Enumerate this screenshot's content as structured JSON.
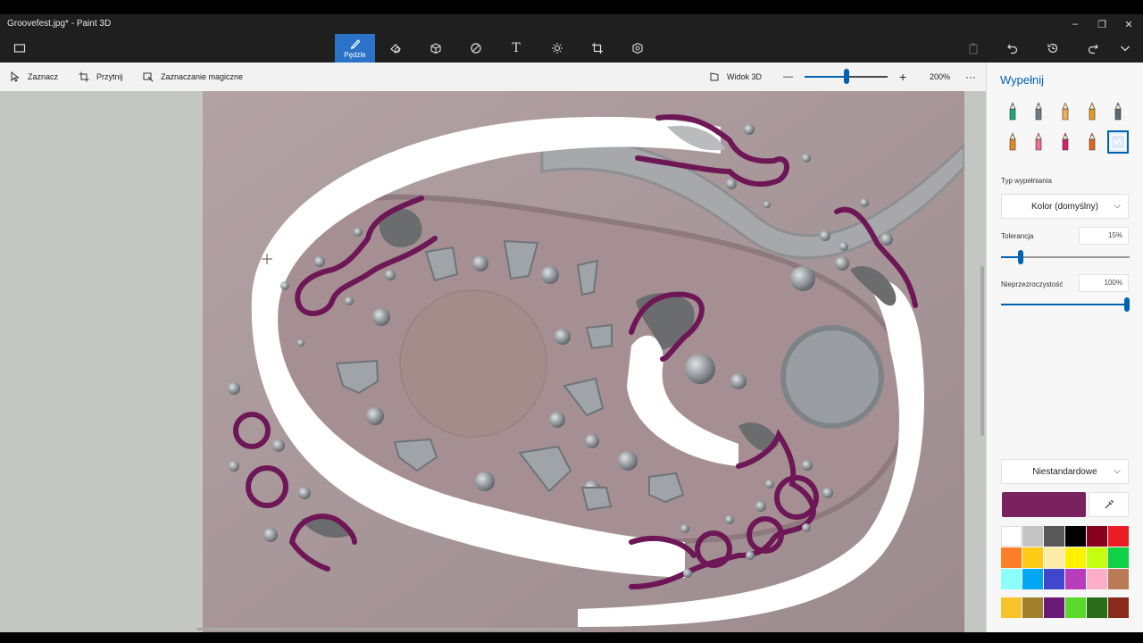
{
  "window": {
    "title": "Groovefest.jpg* - Paint 3D",
    "controls": {
      "minimize": "–",
      "maximize": "❐",
      "close": "✕"
    }
  },
  "toolbar": {
    "menu_icon": "folder-icon",
    "tools": [
      {
        "name": "brushes",
        "label": "Pędzle",
        "icon": "brush-icon",
        "active": true
      },
      {
        "name": "shapes2d",
        "icon": "shapes-2d-icon"
      },
      {
        "name": "shapes3d",
        "icon": "cube-icon"
      },
      {
        "name": "stickers",
        "icon": "sticker-icon"
      },
      {
        "name": "text",
        "icon": "text-icon",
        "glyph": "T"
      },
      {
        "name": "effects",
        "icon": "sun-icon"
      },
      {
        "name": "canvas",
        "icon": "crop-canvas-icon"
      },
      {
        "name": "library",
        "icon": "library-3d-icon"
      }
    ],
    "right": [
      "paste-icon",
      "undo-icon",
      "history-icon",
      "redo-icon",
      "expand-icon"
    ]
  },
  "subbar": {
    "select": "Zaznacz",
    "crop": "Przytnij",
    "magic_select": "Zaznaczanie magiczne",
    "view3d": "Widok 3D",
    "zoom_out": "—",
    "zoom_in": "+",
    "zoom_value": "200%",
    "zoom_fraction": 0.5,
    "more": "···"
  },
  "panel": {
    "title": "Wypełnij",
    "brushes": [
      {
        "icon": "marker-icon",
        "color": "#1fa67a"
      },
      {
        "icon": "calligraphy-pen-icon",
        "color": "#6f7b82"
      },
      {
        "icon": "oil-brush-icon",
        "color": "#f2b04c"
      },
      {
        "icon": "watercolor-icon",
        "color": "#e59a2a"
      },
      {
        "icon": "pixel-pen-icon",
        "color": "#5b6770"
      },
      {
        "icon": "pencil-icon",
        "color": "#e28a2a"
      },
      {
        "icon": "eraser-icon",
        "color": "#ee6e91"
      },
      {
        "icon": "crayon-icon",
        "color": "#d6206b"
      },
      {
        "icon": "spray-can-icon",
        "color": "#e0661e"
      },
      {
        "icon": "fill-icon",
        "color": "#2b73c8",
        "selected": true
      }
    ],
    "fill_type_label": "Typ wypełniania",
    "fill_type_value": "Kolor (domyślny)",
    "tolerance_label": "Tolerancja",
    "tolerance_value": "15%",
    "tolerance_fraction": 0.15,
    "opacity_label": "Nieprzezroczystość",
    "opacity_value": "100%",
    "opacity_fraction": 1.0,
    "custom_label": "Niestandardowe",
    "current_color": "#7a2260",
    "palette": [
      "#ffffff",
      "#c3c3c3",
      "#585858",
      "#000000",
      "#88001b",
      "#ec1c24",
      "#ff7f27",
      "#ffca18",
      "#fdeca6",
      "#fff200",
      "#c4ff0e",
      "#0ed145",
      "#8cfffb",
      "#00a8f3",
      "#3f48cc",
      "#b83dba",
      "#ffaec8",
      "#b97a56"
    ],
    "palette_custom": [
      "#f8c22a",
      "#a0802a",
      "#6b1a7a",
      "#5ad82c",
      "#2b6e1a",
      "#8a2a1a"
    ]
  }
}
